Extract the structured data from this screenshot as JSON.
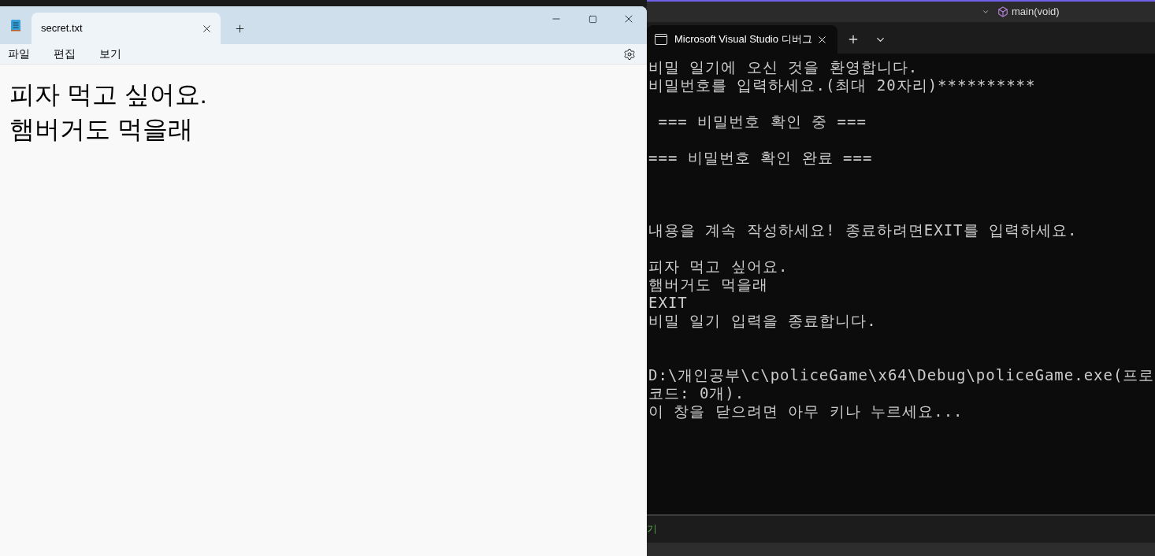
{
  "vs_toolbar": {
    "function_scope": "main(void)"
  },
  "notepad": {
    "tabs": [
      {
        "title": "secret.txt",
        "selected": true
      }
    ],
    "menu": [
      "파일",
      "편집",
      "보기"
    ],
    "lines": [
      "피자 먹고 싶어요.",
      "햄버거도 먹을래"
    ]
  },
  "console": {
    "tab_title": "Microsoft Visual Studio 디버그",
    "lines": [
      {
        "kind": "text",
        "text": "비밀 일기에 오신 것을 환영합니다."
      },
      {
        "kind": "text",
        "text": "비밀번호를 입력하세요.(최대 20자리)**********"
      },
      {
        "kind": "blank"
      },
      {
        "kind": "text",
        "text": " === 비밀번호 확인 중 ==="
      },
      {
        "kind": "blank"
      },
      {
        "kind": "text",
        "text": "=== 비밀번호 확인 완료 ==="
      },
      {
        "kind": "blank"
      },
      {
        "kind": "blank"
      },
      {
        "kind": "blank"
      },
      {
        "kind": "text",
        "text": "내용을 계속 작성하세요! 종료하려면EXIT를 입력하세요."
      },
      {
        "kind": "blank"
      },
      {
        "kind": "text",
        "text": "피자 먹고 싶어요."
      },
      {
        "kind": "text",
        "text": "햄버거도 먹을래"
      },
      {
        "kind": "text",
        "text": "EXIT"
      },
      {
        "kind": "text",
        "text": "비밀 일기 입력을 종료합니다."
      },
      {
        "kind": "blank"
      },
      {
        "kind": "blank"
      },
      {
        "kind": "text",
        "text": "D:\\개인공부\\c\\policeGame\\x64\\Debug\\policeGame.exe(프로"
      },
      {
        "kind": "text",
        "text": "코드: 0개)."
      },
      {
        "kind": "text",
        "text": "이 창을 닫으려면 아무 키나 누르세요..."
      }
    ]
  },
  "vs_output": {
    "text": "기"
  }
}
